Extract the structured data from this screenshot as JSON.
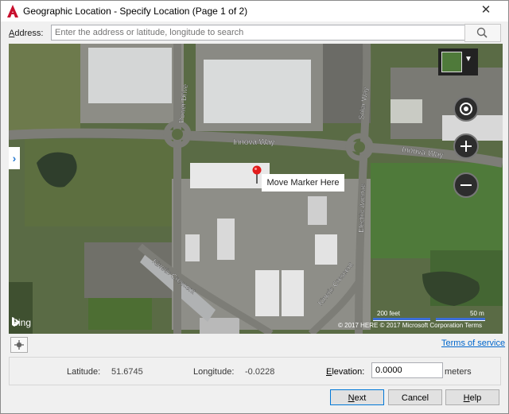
{
  "window": {
    "title": "Geographic Location - Specify Location (Page 1 of 2)",
    "close_glyph": "✕"
  },
  "address": {
    "label_first": "A",
    "label_rest": "ddress:",
    "placeholder": "Enter the address or latitude, longitude to search",
    "value": ""
  },
  "map": {
    "tooltip": "Move Marker Here",
    "side_tab_glyph": "›",
    "map_type_caret": "▼",
    "bing_label": "Bing",
    "copyright": "© 2017 HERE © 2017 Microsoft Corporation  Terms",
    "scale_imperial": "200 feet",
    "scale_metric": "50 m",
    "street_labels": [
      "Power Drive",
      "Innova Way",
      "Innova Way",
      "Solar Way",
      "Electric Avenue",
      "Kinetic Crescent",
      "Kinetic Crescent"
    ],
    "icons": [
      "map-marker-icon",
      "locate-icon",
      "zoom-in-icon",
      "zoom-out-icon",
      "map-type-icon"
    ]
  },
  "terms_link": "Terms of service",
  "coordinates": {
    "latitude_label": "Latitude:",
    "latitude_value": "51.6745",
    "longitude_label": "Longitude:",
    "longitude_value": "-0.0228",
    "elevation_label_first": "E",
    "elevation_label_rest": "levation:",
    "elevation_value": "0.0000",
    "elevation_unit": "meters"
  },
  "buttons": {
    "next_first": "N",
    "next_rest": "ext",
    "cancel": "Cancel",
    "help_first": "H",
    "help_rest": "elp"
  },
  "colors": {
    "accent": "#0078d7",
    "autocad_red": "#c8102e",
    "link": "#0066cc"
  }
}
